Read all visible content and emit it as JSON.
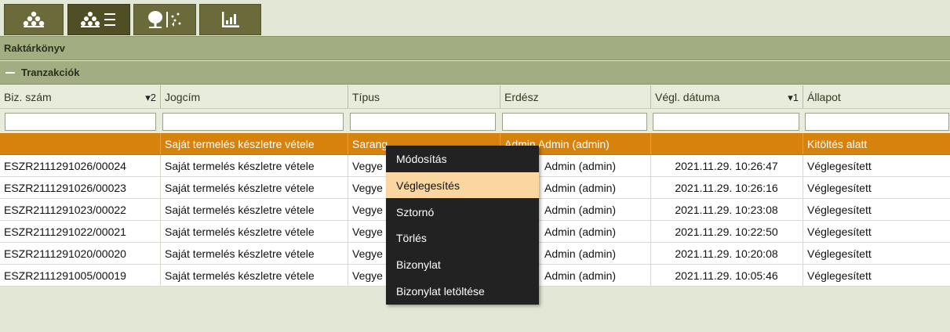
{
  "toolbar": {
    "buttons": [
      {
        "icon": "forest-icon"
      },
      {
        "icon": "forest-list-icon",
        "active": true
      },
      {
        "icon": "tree-transfer-icon"
      },
      {
        "icon": "chart-icon"
      }
    ]
  },
  "section": {
    "title": "Raktárkönyv",
    "subtitle": "Tranzakciók"
  },
  "grid": {
    "columns": [
      {
        "label": "Biz. szám",
        "sort": "▾2"
      },
      {
        "label": "Jogcím",
        "sort": ""
      },
      {
        "label": "Típus",
        "sort": ""
      },
      {
        "label": "Erdész",
        "sort": ""
      },
      {
        "label": "Végl. dátuma",
        "sort": "▾1"
      },
      {
        "label": "Állapot",
        "sort": ""
      }
    ],
    "rows": [
      {
        "biz": "",
        "jogcim": "Saját termelés készletre vétele",
        "tipus": "Sarang",
        "erdesz": "Admin Admin (admin)",
        "datum": "",
        "allapot": "Kitöltés alatt"
      },
      {
        "biz": "ESZR2111291026/00024",
        "jogcim": "Saját termelés készletre vétele",
        "tipus": "Vegye",
        "erdesz": "Admin (admin)",
        "datum": "2021.11.29. 10:26:47",
        "allapot": "Véglegesített"
      },
      {
        "biz": "ESZR2111291026/00023",
        "jogcim": "Saját termelés készletre vétele",
        "tipus": "Vegye",
        "erdesz": "Admin (admin)",
        "datum": "2021.11.29. 10:26:16",
        "allapot": "Véglegesített"
      },
      {
        "biz": "ESZR2111291023/00022",
        "jogcim": "Saját termelés készletre vétele",
        "tipus": "Vegye",
        "erdesz": "Admin (admin)",
        "datum": "2021.11.29. 10:23:08",
        "allapot": "Véglegesített"
      },
      {
        "biz": "ESZR2111291022/00021",
        "jogcim": "Saját termelés készletre vétele",
        "tipus": "Vegye",
        "erdesz": "Admin (admin)",
        "datum": "2021.11.29. 10:22:50",
        "allapot": "Véglegesített"
      },
      {
        "biz": "ESZR2111291020/00020",
        "jogcim": "Saját termelés készletre vétele",
        "tipus": "Vegye",
        "erdesz": "Admin (admin)",
        "datum": "2021.11.29. 10:20:08",
        "allapot": "Véglegesített"
      },
      {
        "biz": "ESZR2111291005/00019",
        "jogcim": "Saját termelés készletre vétele",
        "tipus": "Vegye",
        "erdesz": "Admin (admin)",
        "datum": "2021.11.29. 10:05:46",
        "allapot": "Véglegesített"
      }
    ]
  },
  "context_menu": {
    "items": [
      {
        "label": "Módosítás"
      },
      {
        "label": "Véglegesítés",
        "highlighted": true
      },
      {
        "label": "Sztornó"
      },
      {
        "label": "Törlés"
      },
      {
        "label": "Bizonylat"
      },
      {
        "label": "Bizonylat letöltése"
      }
    ]
  },
  "colors": {
    "selected_row": "#d6820c",
    "menu_bg": "#222222",
    "menu_highlight": "#fad7a0",
    "toolbar_btn": "#6b6a3a",
    "section_bar": "#a3ad82"
  }
}
